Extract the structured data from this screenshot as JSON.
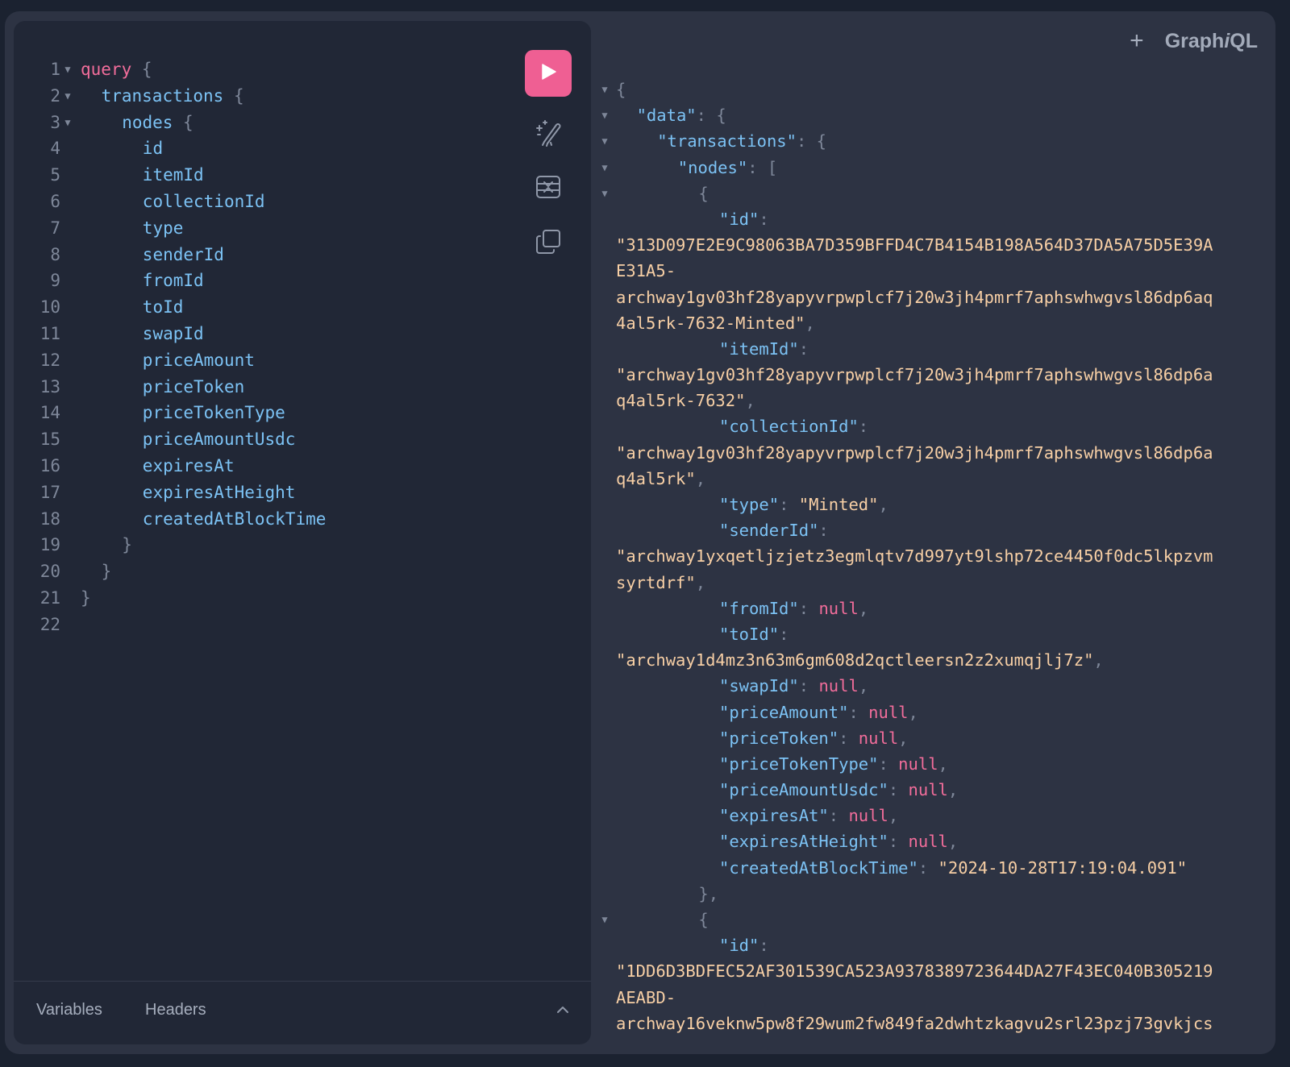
{
  "app": {
    "logo": "GraphiQL",
    "add_tab": "+"
  },
  "query_lines": [
    {
      "n": "1",
      "fold": true,
      "indent": 0,
      "parts": [
        {
          "t": "query",
          "c": "kw"
        },
        {
          "t": " {",
          "c": "punc"
        }
      ]
    },
    {
      "n": "2",
      "fold": true,
      "indent": 1,
      "parts": [
        {
          "t": "transactions",
          "c": "fld"
        },
        {
          "t": " {",
          "c": "punc"
        }
      ]
    },
    {
      "n": "3",
      "fold": true,
      "indent": 2,
      "parts": [
        {
          "t": "nodes",
          "c": "fld"
        },
        {
          "t": " {",
          "c": "punc"
        }
      ]
    },
    {
      "n": "4",
      "indent": 3,
      "parts": [
        {
          "t": "id",
          "c": "fld"
        }
      ]
    },
    {
      "n": "5",
      "indent": 3,
      "parts": [
        {
          "t": "itemId",
          "c": "fld"
        }
      ]
    },
    {
      "n": "6",
      "indent": 3,
      "parts": [
        {
          "t": "collectionId",
          "c": "fld"
        }
      ]
    },
    {
      "n": "7",
      "indent": 3,
      "parts": [
        {
          "t": "type",
          "c": "fld"
        }
      ]
    },
    {
      "n": "8",
      "indent": 3,
      "parts": [
        {
          "t": "senderId",
          "c": "fld"
        }
      ]
    },
    {
      "n": "9",
      "indent": 3,
      "parts": [
        {
          "t": "fromId",
          "c": "fld"
        }
      ]
    },
    {
      "n": "10",
      "indent": 3,
      "parts": [
        {
          "t": "toId",
          "c": "fld"
        }
      ]
    },
    {
      "n": "11",
      "indent": 3,
      "parts": [
        {
          "t": "swapId",
          "c": "fld"
        }
      ]
    },
    {
      "n": "12",
      "indent": 3,
      "parts": [
        {
          "t": "priceAmount",
          "c": "fld"
        }
      ]
    },
    {
      "n": "13",
      "indent": 3,
      "parts": [
        {
          "t": "priceToken",
          "c": "fld"
        }
      ]
    },
    {
      "n": "14",
      "indent": 3,
      "parts": [
        {
          "t": "priceTokenType",
          "c": "fld"
        }
      ]
    },
    {
      "n": "15",
      "indent": 3,
      "parts": [
        {
          "t": "priceAmountUsdc",
          "c": "fld"
        }
      ]
    },
    {
      "n": "16",
      "indent": 3,
      "parts": [
        {
          "t": "expiresAt",
          "c": "fld"
        }
      ]
    },
    {
      "n": "17",
      "indent": 3,
      "parts": [
        {
          "t": "expiresAtHeight",
          "c": "fld"
        }
      ]
    },
    {
      "n": "18",
      "indent": 3,
      "parts": [
        {
          "t": "createdAtBlockTime",
          "c": "fld"
        }
      ]
    },
    {
      "n": "19",
      "indent": 2,
      "parts": [
        {
          "t": "}",
          "c": "punc"
        }
      ]
    },
    {
      "n": "20",
      "indent": 1,
      "parts": [
        {
          "t": "}",
          "c": "punc"
        }
      ]
    },
    {
      "n": "21",
      "indent": 0,
      "parts": [
        {
          "t": "}",
          "c": "punc"
        }
      ]
    },
    {
      "n": "22",
      "indent": 0,
      "parts": []
    }
  ],
  "toolbar": {
    "run": "play-icon",
    "prettify": "magic-wand-icon",
    "merge": "merge-fragments-icon",
    "copy": "copy-icon"
  },
  "editor_tabs": {
    "variables": "Variables",
    "headers": "Headers"
  },
  "response_lines": [
    {
      "fold": true,
      "indent": 0,
      "parts": [
        {
          "t": "{",
          "c": "punc"
        }
      ]
    },
    {
      "fold": true,
      "indent": 1,
      "parts": [
        {
          "t": "\"data\"",
          "c": "key"
        },
        {
          "t": ": {",
          "c": "punc"
        }
      ]
    },
    {
      "fold": true,
      "indent": 2,
      "parts": [
        {
          "t": "\"transactions\"",
          "c": "key"
        },
        {
          "t": ": {",
          "c": "punc"
        }
      ]
    },
    {
      "fold": true,
      "indent": 3,
      "parts": [
        {
          "t": "\"nodes\"",
          "c": "key"
        },
        {
          "t": ": [",
          "c": "punc"
        }
      ]
    },
    {
      "fold": true,
      "indent": 4,
      "parts": [
        {
          "t": "{",
          "c": "punc"
        }
      ]
    },
    {
      "indent": 5,
      "parts": [
        {
          "t": "\"id\"",
          "c": "key"
        },
        {
          "t": ":",
          "c": "punc"
        }
      ]
    },
    {
      "indent": 0,
      "parts": [
        {
          "t": "\"313D097E2E9C98063BA7D359BFFD4C7B4154B198A564D37DA5A75D5E39A",
          "c": "str"
        }
      ]
    },
    {
      "indent": 0,
      "parts": [
        {
          "t": "E31A5-",
          "c": "str"
        }
      ]
    },
    {
      "indent": 0,
      "parts": [
        {
          "t": "archway1gv03hf28yapyvrpwplcf7j20w3jh4pmrf7aphswhwgvsl86dp6aq",
          "c": "str"
        }
      ]
    },
    {
      "indent": 0,
      "parts": [
        {
          "t": "4al5rk-7632-Minted\"",
          "c": "str"
        },
        {
          "t": ",",
          "c": "punc"
        }
      ]
    },
    {
      "indent": 5,
      "parts": [
        {
          "t": "\"itemId\"",
          "c": "key"
        },
        {
          "t": ":",
          "c": "punc"
        }
      ]
    },
    {
      "indent": 0,
      "parts": [
        {
          "t": "\"archway1gv03hf28yapyvrpwplcf7j20w3jh4pmrf7aphswhwgvsl86dp6a",
          "c": "str"
        }
      ]
    },
    {
      "indent": 0,
      "parts": [
        {
          "t": "q4al5rk-7632\"",
          "c": "str"
        },
        {
          "t": ",",
          "c": "punc"
        }
      ]
    },
    {
      "indent": 5,
      "parts": [
        {
          "t": "\"collectionId\"",
          "c": "key"
        },
        {
          "t": ":",
          "c": "punc"
        }
      ]
    },
    {
      "indent": 0,
      "parts": [
        {
          "t": "\"archway1gv03hf28yapyvrpwplcf7j20w3jh4pmrf7aphswhwgvsl86dp6a",
          "c": "str"
        }
      ]
    },
    {
      "indent": 0,
      "parts": [
        {
          "t": "q4al5rk\"",
          "c": "str"
        },
        {
          "t": ",",
          "c": "punc"
        }
      ]
    },
    {
      "indent": 5,
      "parts": [
        {
          "t": "\"type\"",
          "c": "key"
        },
        {
          "t": ": ",
          "c": "punc"
        },
        {
          "t": "\"Minted\"",
          "c": "str"
        },
        {
          "t": ",",
          "c": "punc"
        }
      ]
    },
    {
      "indent": 5,
      "parts": [
        {
          "t": "\"senderId\"",
          "c": "key"
        },
        {
          "t": ":",
          "c": "punc"
        }
      ]
    },
    {
      "indent": 0,
      "parts": [
        {
          "t": "\"archway1yxqetljzjetz3egmlqtv7d997yt9lshp72ce4450f0dc5lkpzvm",
          "c": "str"
        }
      ]
    },
    {
      "indent": 0,
      "parts": [
        {
          "t": "syrtdrf\"",
          "c": "str"
        },
        {
          "t": ",",
          "c": "punc"
        }
      ]
    },
    {
      "indent": 5,
      "parts": [
        {
          "t": "\"fromId\"",
          "c": "key"
        },
        {
          "t": ": ",
          "c": "punc"
        },
        {
          "t": "null",
          "c": "nul"
        },
        {
          "t": ",",
          "c": "punc"
        }
      ]
    },
    {
      "indent": 5,
      "parts": [
        {
          "t": "\"toId\"",
          "c": "key"
        },
        {
          "t": ":",
          "c": "punc"
        }
      ]
    },
    {
      "indent": 0,
      "parts": [
        {
          "t": "\"archway1d4mz3n63m6gm608d2qctleersn2z2xumqjlj7z\"",
          "c": "str"
        },
        {
          "t": ",",
          "c": "punc"
        }
      ]
    },
    {
      "indent": 5,
      "parts": [
        {
          "t": "\"swapId\"",
          "c": "key"
        },
        {
          "t": ": ",
          "c": "punc"
        },
        {
          "t": "null",
          "c": "nul"
        },
        {
          "t": ",",
          "c": "punc"
        }
      ]
    },
    {
      "indent": 5,
      "parts": [
        {
          "t": "\"priceAmount\"",
          "c": "key"
        },
        {
          "t": ": ",
          "c": "punc"
        },
        {
          "t": "null",
          "c": "nul"
        },
        {
          "t": ",",
          "c": "punc"
        }
      ]
    },
    {
      "indent": 5,
      "parts": [
        {
          "t": "\"priceToken\"",
          "c": "key"
        },
        {
          "t": ": ",
          "c": "punc"
        },
        {
          "t": "null",
          "c": "nul"
        },
        {
          "t": ",",
          "c": "punc"
        }
      ]
    },
    {
      "indent": 5,
      "parts": [
        {
          "t": "\"priceTokenType\"",
          "c": "key"
        },
        {
          "t": ": ",
          "c": "punc"
        },
        {
          "t": "null",
          "c": "nul"
        },
        {
          "t": ",",
          "c": "punc"
        }
      ]
    },
    {
      "indent": 5,
      "parts": [
        {
          "t": "\"priceAmountUsdc\"",
          "c": "key"
        },
        {
          "t": ": ",
          "c": "punc"
        },
        {
          "t": "null",
          "c": "nul"
        },
        {
          "t": ",",
          "c": "punc"
        }
      ]
    },
    {
      "indent": 5,
      "parts": [
        {
          "t": "\"expiresAt\"",
          "c": "key"
        },
        {
          "t": ": ",
          "c": "punc"
        },
        {
          "t": "null",
          "c": "nul"
        },
        {
          "t": ",",
          "c": "punc"
        }
      ]
    },
    {
      "indent": 5,
      "parts": [
        {
          "t": "\"expiresAtHeight\"",
          "c": "key"
        },
        {
          "t": ": ",
          "c": "punc"
        },
        {
          "t": "null",
          "c": "nul"
        },
        {
          "t": ",",
          "c": "punc"
        }
      ]
    },
    {
      "indent": 5,
      "parts": [
        {
          "t": "\"createdAtBlockTime\"",
          "c": "key"
        },
        {
          "t": ": ",
          "c": "punc"
        },
        {
          "t": "\"2024-10-28T17:19:04.091\"",
          "c": "str"
        }
      ]
    },
    {
      "indent": 4,
      "parts": [
        {
          "t": "},",
          "c": "punc"
        }
      ]
    },
    {
      "fold": true,
      "indent": 4,
      "parts": [
        {
          "t": "{",
          "c": "punc"
        }
      ]
    },
    {
      "indent": 5,
      "parts": [
        {
          "t": "\"id\"",
          "c": "key"
        },
        {
          "t": ":",
          "c": "punc"
        }
      ]
    },
    {
      "indent": 0,
      "parts": [
        {
          "t": "\"1DD6D3BDFEC52AF301539CA523A9378389723644DA27F43EC040B305219",
          "c": "str"
        }
      ]
    },
    {
      "indent": 0,
      "parts": [
        {
          "t": "AEABD-",
          "c": "str"
        }
      ]
    },
    {
      "indent": 0,
      "parts": [
        {
          "t": "archway16veknw5pw8f29wum2fw849fa2dwhtzkagvu2srl23pzj73gvkjcs",
          "c": "str"
        }
      ]
    }
  ],
  "colors": {
    "accent": "#ef5f93",
    "keyword": "#f26d9b",
    "field": "#7cc2f4",
    "string": "#f7cfa5",
    "null": "#f26d9b",
    "punctuation": "#7e8799",
    "panel": "#212736",
    "background": "#2d3343"
  }
}
